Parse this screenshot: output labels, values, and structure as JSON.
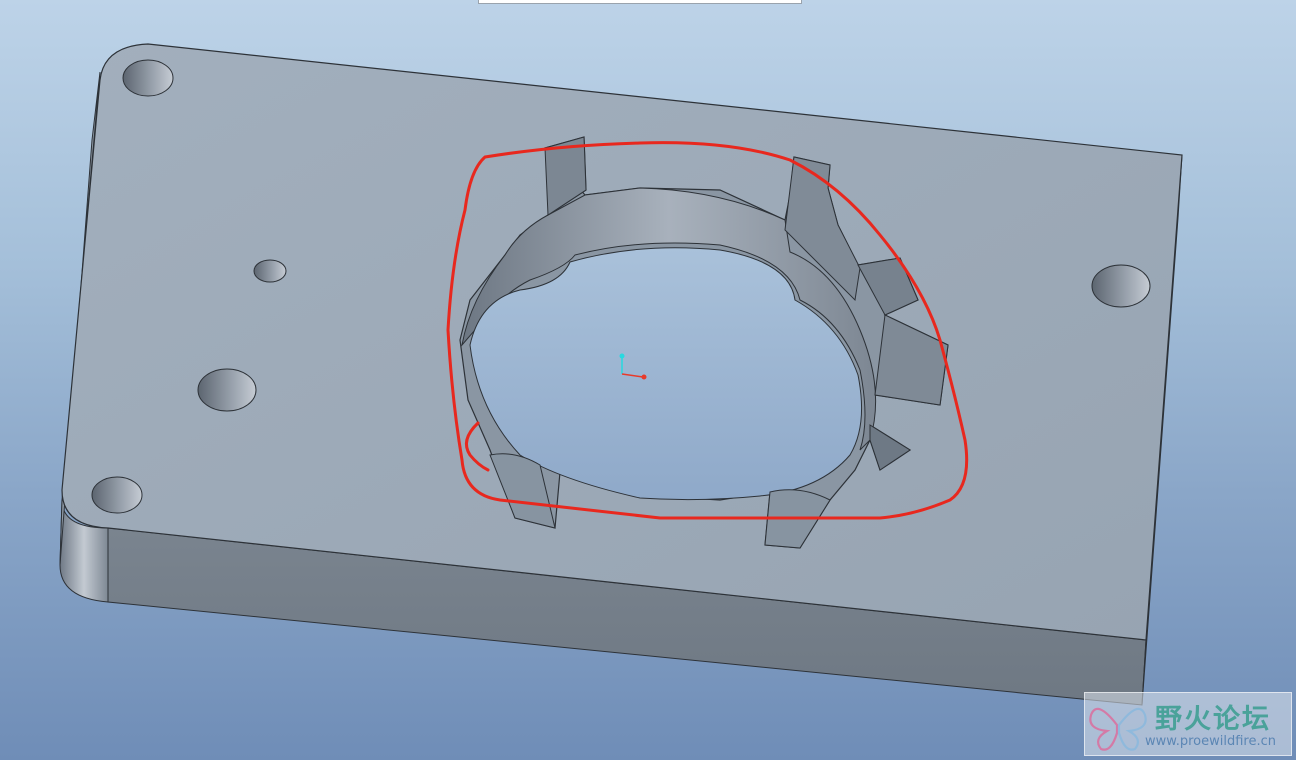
{
  "viewport": {
    "background_top": "#bdd3e8",
    "background_bottom": "#6f8db7",
    "model_color": "#9aa7b5",
    "model_side_color": "#76808b",
    "annotation_color": "#e8281e"
  },
  "watermark": {
    "title": "野火论坛",
    "url": "www.proewildfire.cn",
    "logo_icon": "butterfly-logo"
  }
}
